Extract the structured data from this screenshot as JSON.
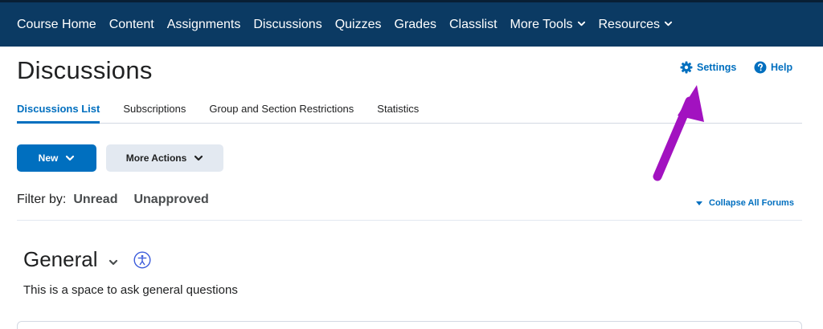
{
  "nav": {
    "items": [
      {
        "label": "Course Home"
      },
      {
        "label": "Content"
      },
      {
        "label": "Assignments"
      },
      {
        "label": "Discussions"
      },
      {
        "label": "Quizzes"
      },
      {
        "label": "Grades"
      },
      {
        "label": "Classlist"
      },
      {
        "label": "More Tools",
        "has_dropdown": true
      },
      {
        "label": "Resources",
        "has_dropdown": true
      }
    ],
    "background": "#0b3a63"
  },
  "page": {
    "title": "Discussions",
    "settings_label": "Settings",
    "help_label": "Help"
  },
  "tabs": [
    {
      "label": "Discussions List",
      "active": true
    },
    {
      "label": "Subscriptions"
    },
    {
      "label": "Group and Section Restrictions"
    },
    {
      "label": "Statistics"
    }
  ],
  "toolbar": {
    "new_label": "New",
    "more_actions_label": "More Actions"
  },
  "filter": {
    "label": "Filter by:",
    "options": [
      "Unread",
      "Unapproved"
    ]
  },
  "collapse_label": "Collapse All Forums",
  "forum": {
    "title": "General",
    "description": "This is a space to ask general questions"
  },
  "icons": {
    "settings": "gear-icon",
    "help": "help-icon",
    "dropdown": "chevron-down-icon",
    "accessibility": "accessibility-icon",
    "annotation": "arrow-annotation"
  },
  "colors": {
    "accent": "#006fbf",
    "annotation": "#a212c0",
    "secondary_button": "#e3e9f1"
  }
}
